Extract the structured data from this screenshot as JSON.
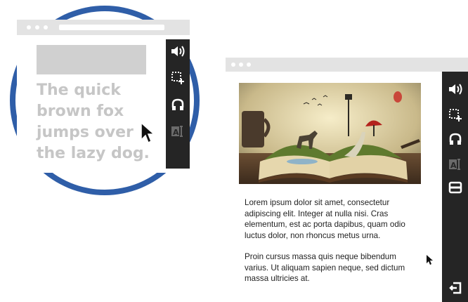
{
  "zoom_preview": {
    "text": "The quick\nbrown fox\njumps over\nthe lazy dog."
  },
  "reader_toolbar": {
    "icons": [
      "speaker-icon",
      "select-region-icon",
      "headphones-icon",
      "text-select-icon",
      "minimize-icon",
      "exit-icon"
    ]
  },
  "article": {
    "paragraph_1": "Lorem ipsum dolor sit amet, consectetur adipiscing elit. Integer at nulla nisi. Cras elementum, est ac porta dapibus, quam odio luctus dolor, non rhoncus metus urna.",
    "paragraph_2": "Proin cursus massa quis neque bibendum varius. Ut aliquam sapien neque, sed dictum massa ultricies at."
  },
  "colors": {
    "accent_circle": "#2f5ea8",
    "toolbar": "#252525",
    "titlebar": "#e3e3e3",
    "preview_text": "#c6c6c6"
  }
}
